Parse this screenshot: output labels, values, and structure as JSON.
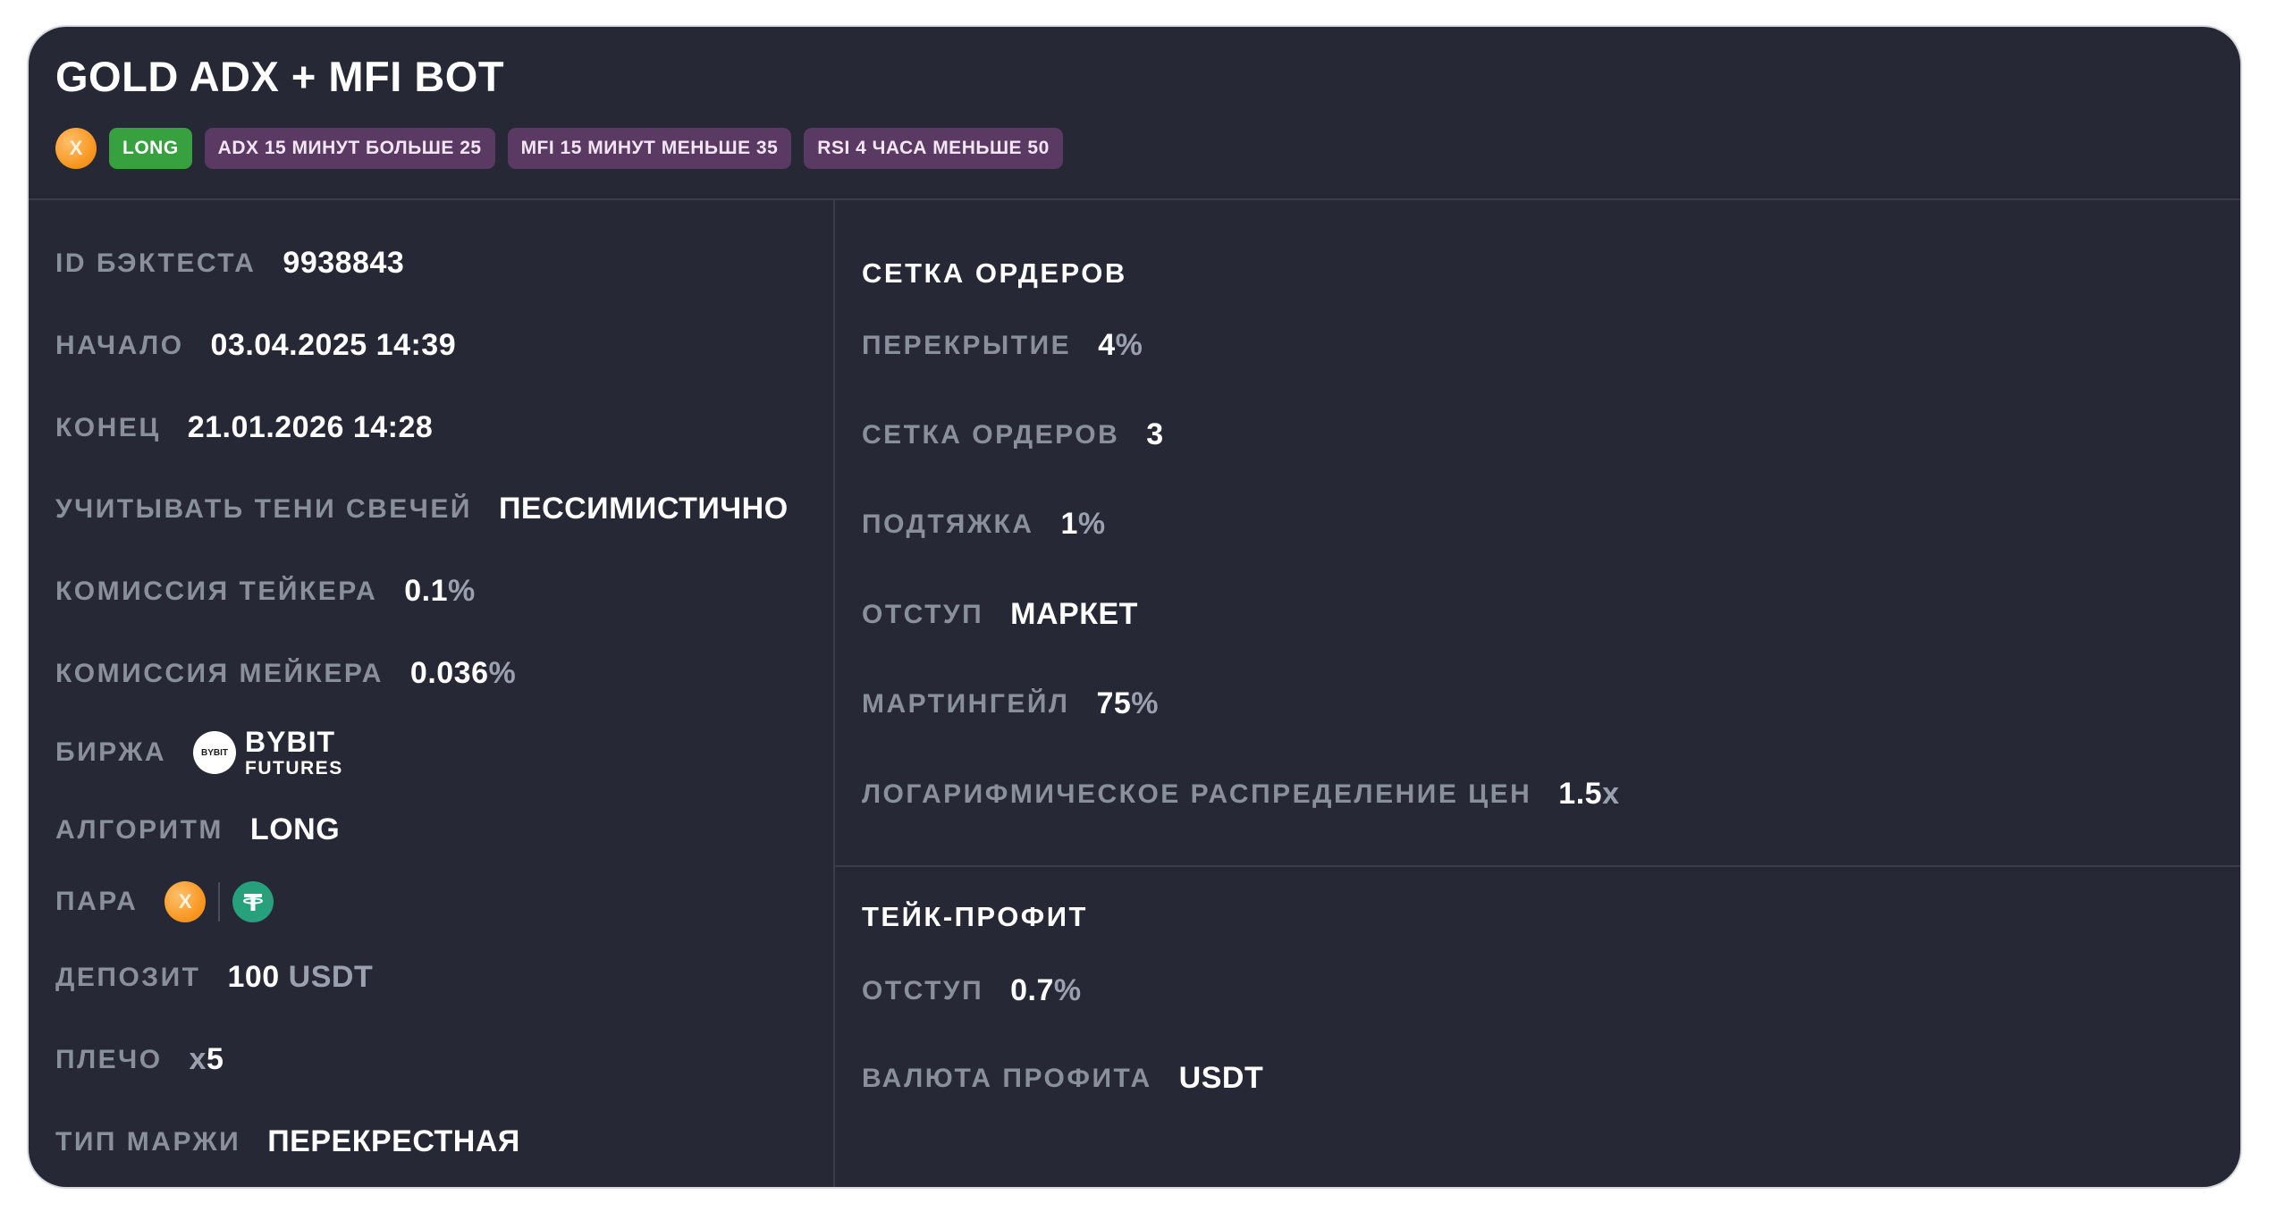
{
  "title": "GOLD ADX + MFI BOT",
  "header_tags": {
    "coin_symbol": "X",
    "direction": "LONG",
    "conditions": [
      "ADX 15 МИНУТ БОЛЬШЕ 25",
      "MFI 15 МИНУТ МЕНЬШЕ 35",
      "RSI 4 ЧАСА МЕНЬШЕ 50"
    ]
  },
  "left": {
    "backtest_id": {
      "label": "ID БЭКТЕСТА",
      "value": "9938843"
    },
    "start": {
      "label": "НАЧАЛО",
      "value": "03.04.2025 14:39"
    },
    "end": {
      "label": "КОНЕЦ",
      "value": "21.01.2026 14:28"
    },
    "shadows": {
      "label": "УЧИТЫВАТЬ ТЕНИ СВЕЧЕЙ",
      "value": "ПЕССИМИСТИЧНО"
    },
    "taker_fee": {
      "label": "КОМИССИЯ ТЕЙКЕРА",
      "value": "0.1",
      "unit": "%"
    },
    "maker_fee": {
      "label": "КОМИССИЯ МЕЙКЕРА",
      "value": "0.036",
      "unit": "%"
    },
    "exchange": {
      "label": "БИРЖА",
      "logo_text": "BYBIT",
      "name": "BYBIT",
      "sub": "FUTURES"
    },
    "algorithm": {
      "label": "АЛГОРИТМ",
      "value": "LONG"
    },
    "pair": {
      "label": "ПАРА",
      "base_symbol": "X",
      "quote_icon": "tether-icon"
    },
    "deposit": {
      "label": "ДЕПОЗИТ",
      "value": "100",
      "unit": "USDT"
    },
    "leverage": {
      "label": "ПЛЕЧО",
      "prefix": "x",
      "value": "5"
    },
    "margin_type": {
      "label": "ТИП МАРЖИ",
      "value": "ПЕРЕКРЕСТНАЯ"
    }
  },
  "grid": {
    "title": "СЕТКА ОРДЕРОВ",
    "overlap": {
      "label": "ПЕРЕКРЫТИЕ",
      "value": "4",
      "unit": "%"
    },
    "orders": {
      "label": "СЕТКА ОРДЕРОВ",
      "value": "3"
    },
    "pullup": {
      "label": "ПОДТЯЖКА",
      "value": "1",
      "unit": "%"
    },
    "offset": {
      "label": "ОТСТУП",
      "value": "МАРКЕТ"
    },
    "martingale": {
      "label": "МАРТИНГЕЙЛ",
      "value": "75",
      "unit": "%"
    },
    "log_distribution": {
      "label": "ЛОГАРИФМИЧЕСКОЕ РАСПРЕДЕЛЕНИЕ ЦЕН",
      "value": "1.5",
      "unit": "x"
    }
  },
  "take_profit": {
    "title": "ТЕЙК-ПРОФИТ",
    "offset": {
      "label": "ОТСТУП",
      "value": "0.7",
      "unit": "%"
    },
    "currency": {
      "label": "ВАЛЮТА ПРОФИТА",
      "value": "USDT"
    }
  },
  "colors": {
    "card_bg": "#262935",
    "label": "#8a8f9c",
    "tag_green": "#37a140",
    "tag_purple": "#5a3a62",
    "coin_orange": "#f7931a",
    "tether_green": "#26a17b"
  }
}
